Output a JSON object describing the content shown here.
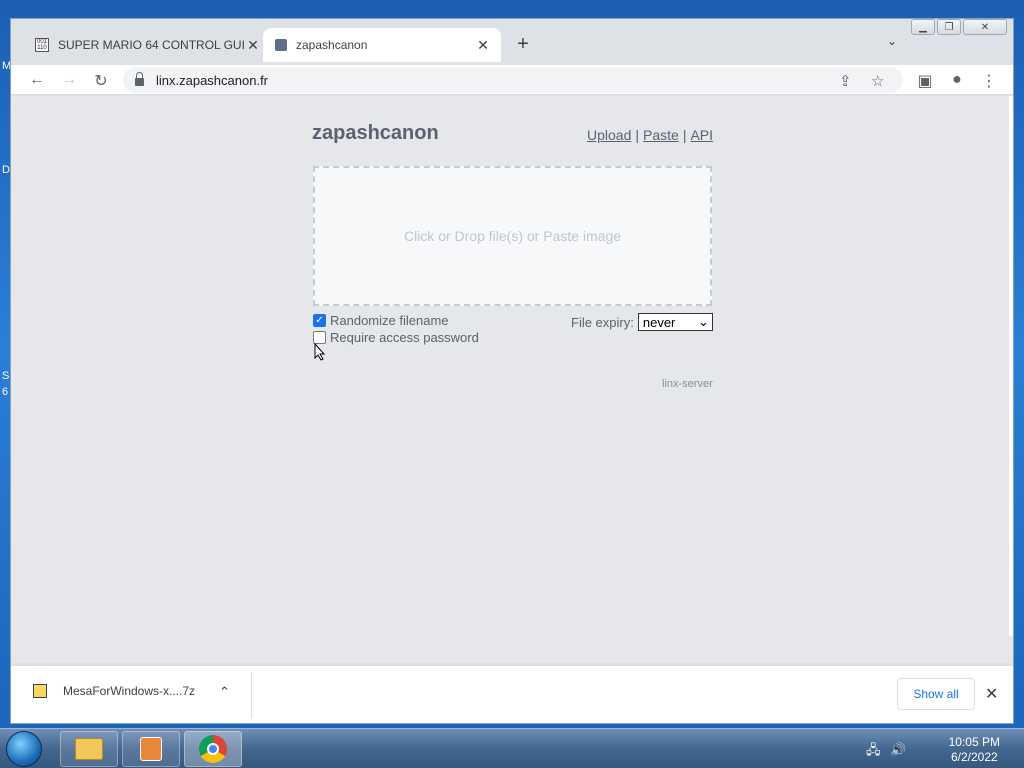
{
  "desktop": {
    "fragments": [
      "M",
      "D",
      "S",
      "6"
    ]
  },
  "browser": {
    "tabs": [
      {
        "title": "SUPER MARIO 64 CONTROL GUI",
        "favicon": "mario-document-icon",
        "active": false
      },
      {
        "title": "zapashcanon",
        "favicon": "site-icon",
        "active": true
      }
    ],
    "url": "linx.zapashcanon.fr"
  },
  "page": {
    "site_title": "zapashcanon",
    "nav": {
      "upload": "Upload",
      "paste": "Paste",
      "api": "API",
      "sep": "|"
    },
    "dropzone_text": "Click or Drop file(s) or Paste image",
    "randomize_label": "Randomize filename",
    "randomize_checked": true,
    "password_label": "Require access password",
    "password_checked": false,
    "expiry_label": "File expiry:",
    "expiry_value": "never",
    "footer": "linx-server"
  },
  "downloads": {
    "filename": "MesaForWindows-x....7z",
    "show_all": "Show all"
  },
  "taskbar": {
    "time": "10:05 PM",
    "date": "6/2/2022"
  },
  "colors": {
    "link": "#1a73e8",
    "page_bg": "#e5e7ea",
    "text": "#5a6270"
  }
}
